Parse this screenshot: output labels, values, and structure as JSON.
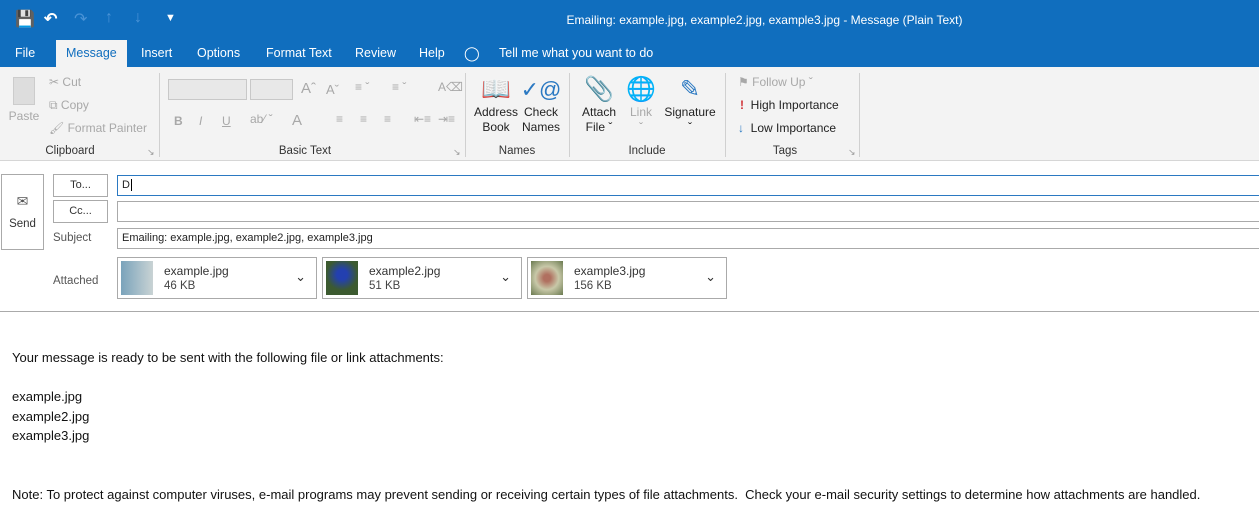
{
  "window": {
    "title": "Emailing: example.jpg, example2.jpg, example3.jpg  -  Message (Plain Text)"
  },
  "quick_access": {
    "save": "save-icon",
    "undo": "undo-icon",
    "redo": "redo-icon",
    "up": "up-icon",
    "down": "down-icon",
    "customize": "customize-icon"
  },
  "tabs": [
    "File",
    "Message",
    "Insert",
    "Options",
    "Format Text",
    "Review",
    "Help"
  ],
  "tell_me": "Tell me what you want to do",
  "ribbon": {
    "clipboard": {
      "label": "Clipboard",
      "paste": "Paste",
      "cut": "Cut",
      "copy": "Copy",
      "format_painter": "Format Painter"
    },
    "basic_text": {
      "label": "Basic Text",
      "bold": "B",
      "italic": "I",
      "underline": "U",
      "font_color": "A"
    },
    "names": {
      "label": "Names",
      "address_book_1": "Address",
      "address_book_2": "Book",
      "check_names_1": "Check",
      "check_names_2": "Names"
    },
    "include": {
      "label": "Include",
      "attach_1": "Attach",
      "attach_2": "File",
      "link": "Link",
      "signature": "Signature"
    },
    "tags": {
      "label": "Tags",
      "follow_up": "Follow Up",
      "high": "High Importance",
      "low": "Low Importance"
    }
  },
  "compose": {
    "send": "Send",
    "to_button": "To...",
    "cc_button": "Cc...",
    "to_value": "D",
    "cc_value": "",
    "subject_label": "Subject",
    "subject_value": "Emailing: example.jpg, example2.jpg, example3.jpg",
    "attached_label": "Attached",
    "attachments": [
      {
        "name": "example.jpg",
        "size": "46 KB"
      },
      {
        "name": "example2.jpg",
        "size": "51 KB"
      },
      {
        "name": "example3.jpg",
        "size": "156 KB"
      }
    ]
  },
  "body": {
    "intro": "Your message is ready to be sent with the following file or link attachments:",
    "files": [
      "example.jpg",
      "example2.jpg",
      "example3.jpg"
    ],
    "note": "Note: To protect against computer viruses, e-mail programs may prevent sending or receiving certain types of file attachments.  Check your e-mail security settings to determine how attachments are handled."
  }
}
